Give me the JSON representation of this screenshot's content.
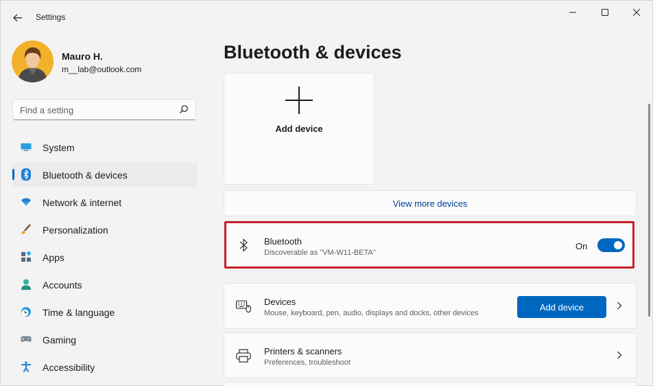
{
  "window": {
    "title": "Settings"
  },
  "profile": {
    "name": "Mauro H.",
    "email": "m__lab@outlook.com"
  },
  "search": {
    "placeholder": "Find a setting"
  },
  "nav": {
    "items": [
      {
        "label": "System",
        "icon": "monitor-icon"
      },
      {
        "label": "Bluetooth & devices",
        "icon": "bluetooth-icon",
        "active": true
      },
      {
        "label": "Network & internet",
        "icon": "wifi-icon"
      },
      {
        "label": "Personalization",
        "icon": "brush-icon"
      },
      {
        "label": "Apps",
        "icon": "apps-icon"
      },
      {
        "label": "Accounts",
        "icon": "person-icon"
      },
      {
        "label": "Time & language",
        "icon": "globe-clock-icon"
      },
      {
        "label": "Gaming",
        "icon": "gamepad-icon"
      },
      {
        "label": "Accessibility",
        "icon": "accessibility-icon"
      }
    ]
  },
  "main": {
    "title": "Bluetooth & devices",
    "add_tile_label": "Add device",
    "view_more_label": "View more devices",
    "bluetooth": {
      "title": "Bluetooth",
      "subtitle": "Discoverable as \"VM-W11-BETA\"",
      "state_label": "On",
      "enabled": true
    },
    "devices": {
      "title": "Devices",
      "subtitle": "Mouse, keyboard, pen, audio, displays and docks, other devices",
      "button_label": "Add device"
    },
    "printers": {
      "title": "Printers & scanners",
      "subtitle": "Preferences, troubleshoot"
    }
  },
  "colors": {
    "accent": "#0067c0",
    "highlight": "#c8202a",
    "background": "#f3f3f3",
    "card": "#fbfbfb"
  }
}
